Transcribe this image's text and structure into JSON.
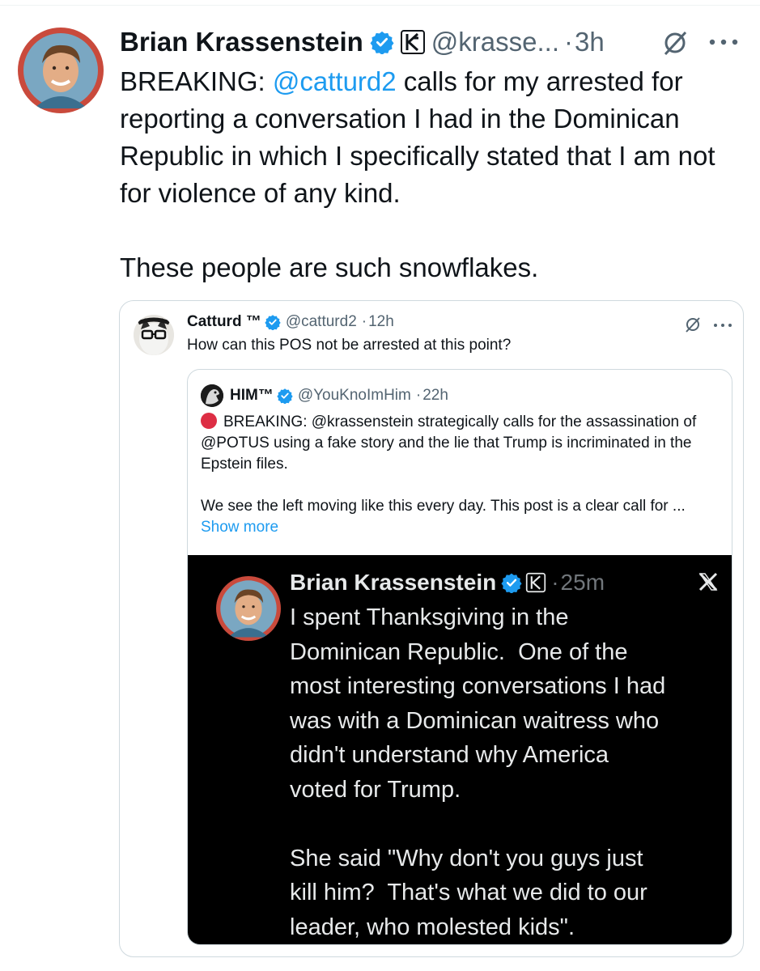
{
  "tweet": {
    "author_name": "Brian Krassenstein",
    "handle": "@krasse...",
    "time": "3h",
    "dot": "·",
    "text_mention": "@catturd2",
    "text_prefix": "BREAKING: ",
    "text_rest": " calls for my arrested for reporting a conversation I had in the Dominican Republic in which I specifically stated that I am not for violence of any kind.\n\nThese people are such snowflakes."
  },
  "quote": {
    "author_name": "Catturd ™",
    "handle": "@catturd2",
    "time": "12h",
    "dot": "·",
    "text": "How can this POS not be arrested at this point?"
  },
  "nested_quote": {
    "author_name": "HIM™",
    "handle": "@YouKnoImHim",
    "time": "22h",
    "dot": "·",
    "text_line1": "BREAKING: @krassenstein strategically calls for the assassination of @POTUS using a fake story and the lie that Trump is incriminated in the Epstein files.",
    "text_line2": "We see the left moving like this every day. This post is a clear call for ...",
    "show_more": "Show more"
  },
  "screenshot": {
    "author_name": "Brian Krassenstein",
    "time": "25m",
    "dot": "·",
    "text": "I spent Thanksgiving in the\nDominican Republic.  One of the\nmost interesting conversations I had\nwas with a Dominican waitress who\ndidn't understand why America\nvoted for Trump.\n\nShe said \"Why don't you guys just\nkill him?  That's what we did to our\nleader, who molested kids\"."
  },
  "icons": {
    "verified": "verified-badge-icon",
    "affiliate": "k-affiliate-icon",
    "grok": "grok-icon",
    "more": "more-icon",
    "x": "x-logo-icon"
  },
  "colors": {
    "link": "#1d9bf0",
    "verified": "#1d9bf0",
    "secondary_text": "#536471",
    "border": "#cfd9de"
  }
}
